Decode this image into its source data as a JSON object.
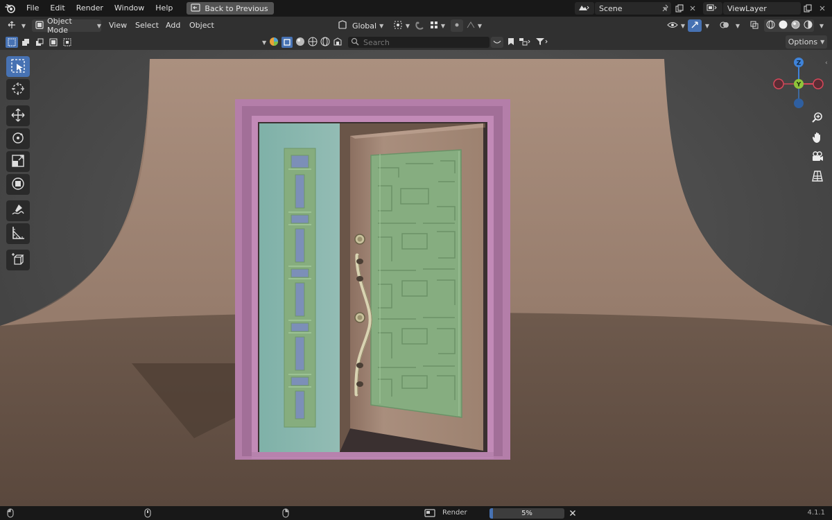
{
  "menu": {
    "file": "File",
    "edit": "Edit",
    "render": "Render",
    "window": "Window",
    "help": "Help"
  },
  "back_button": "Back to Previous",
  "scene": {
    "name": "Scene"
  },
  "view_layer": {
    "name": "ViewLayer"
  },
  "header": {
    "mode": "Object Mode",
    "view": "View",
    "select": "Select",
    "add": "Add",
    "object": "Object",
    "orientation": "Global"
  },
  "toolrow": {
    "search_placeholder": "Search",
    "options": "Options"
  },
  "gizmo": {
    "z": "Z",
    "y": "Y"
  },
  "status": {
    "render_label": "Render",
    "progress": 5,
    "progress_text": "5%",
    "version": "4.1.1"
  },
  "colors": {
    "accent": "#4772b3",
    "door_frame": "#b07aa8",
    "side_panel": "#86b6ae",
    "pattern_green": "#85b07e",
    "door_leaf": "#a38876",
    "backdrop": "#9a8272",
    "axis_x": "#d9475a",
    "axis_y": "#8fc33a",
    "axis_z": "#3f83d9"
  },
  "icons": [
    "blender-logo",
    "back-icon",
    "scene-icon",
    "pin-icon",
    "copy-icon",
    "close-icon",
    "view-layer-icon",
    "editor-type-icon",
    "object-mode-icon",
    "transform-orientation-icon",
    "pivot-icon",
    "snap-icon",
    "proportional-edit-icon",
    "select-box-icon",
    "cursor-icon",
    "move-icon",
    "rotate-icon",
    "scale-icon",
    "transform-icon",
    "annotate-icon",
    "measure-icon",
    "add-cube-icon",
    "zoom-icon",
    "hand-icon",
    "camera-icon",
    "grid-icon",
    "mouse-icon",
    "render-icon"
  ]
}
